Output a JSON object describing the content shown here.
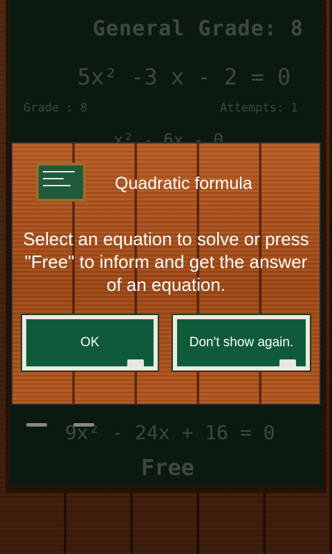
{
  "board": {
    "general_grade": "General Grade: 8",
    "equation_top": "5x² -3 x - 2 = 0",
    "grade": "Grade : 8",
    "attempts": "Attempts: 1",
    "equation_partial": "x² - 6x - 0",
    "equation_bottom": "9x² - 24x + 16 = 0",
    "free_label": "Free"
  },
  "dialog": {
    "title": "Quadratic formula",
    "message": "Select an equation to solve or press \"Free\" to inform and get the answer of an equation.",
    "ok_label": "OK",
    "dont_show_label": "Don't show again."
  },
  "icons": [
    "chalkboard-icon",
    "eraser-icon"
  ]
}
